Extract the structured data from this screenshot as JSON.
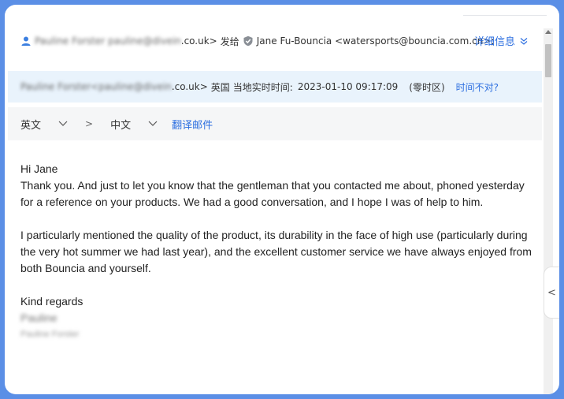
{
  "header": {
    "sender_name_blurred": "Pauline Forster",
    "sender_email_blurred": "pauline@divein",
    "sender_email_suffix": ".co.uk>",
    "sent_to_label": "发给",
    "recipient": "Jane Fu-Bouncia <watersports@bouncia.com.cn>;",
    "details_link": "详细信息"
  },
  "time_bar": {
    "sender_blurred": "Pauline Forster<pauline@divein",
    "sender_suffix": ".co.uk>",
    "country": "英国",
    "local_time_label": "当地实时时间:",
    "local_time": "2023-01-10 09:17:09",
    "timezone": "(零时区)",
    "wrong_time_link": "时间不对?"
  },
  "translate_bar": {
    "source_lang": "英文",
    "arrow": ">",
    "target_lang": "中文",
    "translate_link": "翻译邮件"
  },
  "message": {
    "greeting": "Hi Jane",
    "para1_line1": "Thank you. And just to let you know that the gentleman that you contacted me about, phoned yesterday",
    "para1_line2": "for a reference on your products. We had a good conversation, and I hope I was of help to him.",
    "para2_line1": "I particularly mentioned the quality of the product, its durability in the face of high use (particularly during",
    "para2_line2": "the very hot summer we had last year), and the excellent customer service we have always enjoyed from",
    "para2_line3": "both Bouncia and yourself.",
    "closing": "Kind regards",
    "signature_blurred": "Pauline",
    "signature_full_blurred": "Pauline Forster"
  },
  "side_tab": {
    "glyph": "<"
  },
  "colors": {
    "frame": "#5b8fe6",
    "link": "#2d6fe0",
    "time_bar_bg": "#e9f3fc"
  }
}
